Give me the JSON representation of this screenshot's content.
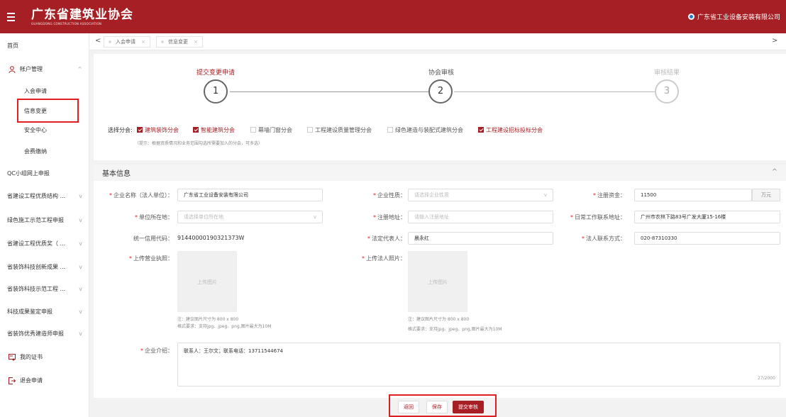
{
  "header": {
    "brand_name": "广东省建筑业协会",
    "brand_sub": "GUANGDONG CONSTRUCTION ASSOCIATION",
    "user_name": "广东省工业设备安装有限公司"
  },
  "sidebar": {
    "home": "首页",
    "account": "帐户管理",
    "join": "入会申请",
    "info_change": "信息变更",
    "security": "安全中心",
    "fee": "会费缴纳",
    "qc": "QC小组网上申报",
    "g1": "省建设工程优质结构 ...",
    "g2": "绿色施工示范工程申报",
    "g3": "省建设工程优质奖（ ...",
    "g4": "省装饰科技创新成果 ...",
    "g5": "省装饰科技示范工程 ...",
    "g6": "科技成果鉴定申报",
    "g7": "省装饰优秀建造师申报",
    "cert": "我的证书",
    "quit": "退会申请"
  },
  "tabs": {
    "t1": "入会申请",
    "t2": "信息变更",
    "close": "×",
    "left": "<",
    "right": ">"
  },
  "steps": {
    "s1": "提交变更申请",
    "s2": "协会审核",
    "s3": "审核结果",
    "n1": "1",
    "n2": "2",
    "n3": "3"
  },
  "branches": {
    "label": "选择分会:",
    "items": [
      {
        "label": "建筑装饰分会",
        "checked": true
      },
      {
        "label": "智能建筑分会",
        "checked": true
      },
      {
        "label": "幕墙门窗分会",
        "checked": false
      },
      {
        "label": "工程建设质量管理分会",
        "checked": false
      },
      {
        "label": "绿色建造与装配式建筑分会",
        "checked": false
      },
      {
        "label": "工程建设招标投标分会",
        "checked": true
      }
    ],
    "hint": "（提示：根据资质情况和业务范围勾选所需要加入的分会，可多选）"
  },
  "section": {
    "title": "基本信息",
    "collapse": "^"
  },
  "form": {
    "company_label": "企业名称（法人单位）：",
    "company_value": "广东省工业设备安装有限公司",
    "nature_label": "企业性质：",
    "nature_placeholder": "请选择企业性质",
    "capital_label": "注册资金：",
    "capital_value": "11500",
    "capital_unit": "万元",
    "location_label": "单位所在地：",
    "location_placeholder": "请选择单位所在地",
    "reg_addr_label": "注册地址：",
    "reg_addr_placeholder": "请输入注册地址",
    "work_addr_label": "日常工作联系地址：",
    "work_addr_value": "广州市农林下路83号广发大厦15-16楼",
    "credit_label": "统一信用代码：",
    "credit_value": "91440000190321373W",
    "legal_rep_label": "法定代表人：",
    "legal_rep_value": "晨永红",
    "legal_phone_label": "法人联系方式：",
    "legal_phone_value": "020-87310330",
    "license_label": "上传营业执照：",
    "legal_photo_label": "上传法人照片：",
    "upload_text": "上传图片",
    "note1": "注：建议图片尺寸为 800 x 800",
    "note2": "格式要求：支持jpg、jpeg、png,图片最大为10M",
    "intro_label": "企业介绍：",
    "intro_value": "联系人：王尔文；联系电话：13711544674",
    "intro_counter": "27/2000",
    "required_mark": "*"
  },
  "buttons": {
    "back": "返回",
    "save": "保存",
    "submit": "提交审核"
  },
  "colors": {
    "brand": "#a51f24",
    "highlight": "#e02020"
  }
}
